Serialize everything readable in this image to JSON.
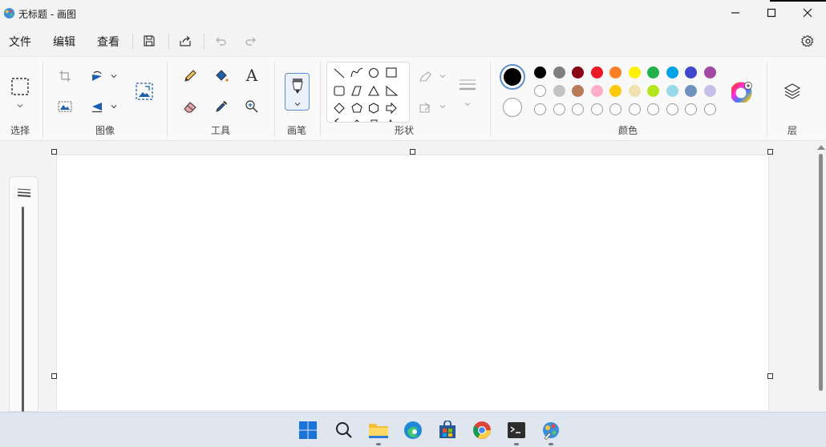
{
  "window": {
    "title": "无标题 - 画图"
  },
  "menu": {
    "file": "文件",
    "edit": "编辑",
    "view": "查看"
  },
  "ribbon": {
    "groups": {
      "select": "选择",
      "image": "图像",
      "tools": "工具",
      "brushes": "画笔",
      "shapes": "形状",
      "colors": "颜色",
      "layers": "层"
    },
    "text_tool_glyph": "A"
  },
  "colors": {
    "primary": "#000000",
    "secondary": "#ffffff",
    "row1": [
      "#000000",
      "#7f7f7f",
      "#880015",
      "#ed1c24",
      "#ff7f27",
      "#fff200",
      "#22b14c",
      "#00a2e8",
      "#3f48cc",
      "#a349a4"
    ],
    "row2": [
      "#ffffff",
      "#c3c3c3",
      "#b97a57",
      "#ffaec9",
      "#ffc90e",
      "#efe4b0",
      "#b5e61d",
      "#99d9ea",
      "#7092be",
      "#c8bfe7"
    ],
    "row3_empty_count": 10,
    "accent": "#5b8fd1"
  },
  "taskbar": {
    "icons": [
      "windows-start-icon",
      "search-icon",
      "file-explorer-icon",
      "edge-icon",
      "store-icon",
      "chrome-icon",
      "terminal-icon",
      "paint-icon"
    ]
  }
}
